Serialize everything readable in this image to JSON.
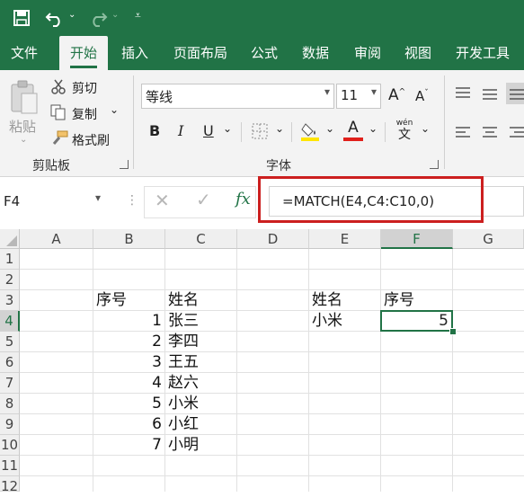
{
  "tabs": [
    "文件",
    "开始",
    "插入",
    "页面布局",
    "公式",
    "数据",
    "审阅",
    "视图",
    "开发工具"
  ],
  "clipboard": {
    "paste": "粘贴",
    "cut": "剪切",
    "copy": "复制",
    "painter": "格式刷",
    "group": "剪贴板"
  },
  "font": {
    "name": "等线",
    "size": "11",
    "bold": "B",
    "italic": "I",
    "underline": "U",
    "group": "字体",
    "grow": "A",
    "shrink": "A",
    "phonetic": "wén",
    "phonetic_char": "文"
  },
  "name_box": "F4",
  "formula": "=MATCH(E4,C4:C10,0)",
  "fx": "fx",
  "columns": [
    "A",
    "B",
    "C",
    "D",
    "E",
    "F",
    "G"
  ],
  "rows": [
    "1",
    "2",
    "3",
    "4",
    "5",
    "6",
    "7",
    "8",
    "9",
    "10",
    "11",
    "12"
  ],
  "table1": {
    "header_num": "序号",
    "header_name": "姓名",
    "nums": [
      "1",
      "2",
      "3",
      "4",
      "5",
      "6",
      "7"
    ],
    "names": [
      "张三",
      "李四",
      "王五",
      "赵六",
      "小米",
      "小红",
      "小明"
    ]
  },
  "lookup": {
    "header_name": "姓名",
    "header_num": "序号",
    "name": "小米",
    "result": "5"
  },
  "colors": {
    "brand": "#217346",
    "highlight_box": "#cc1f1f",
    "font_color": "#e0201b",
    "fill_color": "#ffe500"
  }
}
